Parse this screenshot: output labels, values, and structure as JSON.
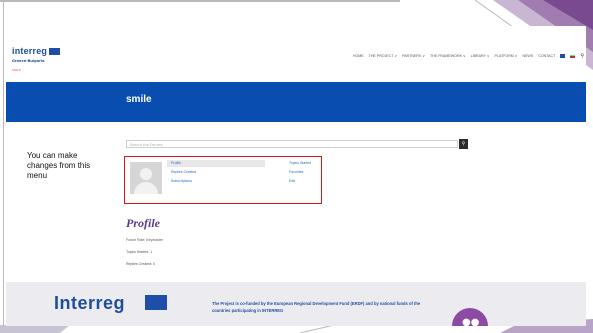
{
  "site": {
    "logo_text": "interreg",
    "logo_subtitle": "Greece-Bulgaria",
    "logo_small": "SMILE"
  },
  "nav": {
    "items": [
      "HOME",
      "THE PROJECT ∨",
      "PARTNERS ∨",
      "THE FRAMEWORK ∨",
      "LIBRARY ∨",
      "PLATFORM ∨",
      "NEWS",
      "CONTACT"
    ],
    "search_icon": "search-icon"
  },
  "banner": {
    "title": "smile"
  },
  "search": {
    "placeholder": "Search the Forums"
  },
  "profile_menu": {
    "col1": [
      "Profile",
      "Replies Created",
      "Subscriptions"
    ],
    "col2": [
      "Topics Started",
      "Favorites",
      "Edit"
    ]
  },
  "profile": {
    "heading": "Profile",
    "role": "Forum Role: Keymaster",
    "topics": "Topics Started: 1",
    "replies": "Replies Created: 0"
  },
  "footer": {
    "logo": "Interreg",
    "text": "The Project is co-funded by the European Regional Development Fund (ERDF) and by national funds of the countries participating in INTERREG"
  },
  "annotation": {
    "text": "You can make changes from this menu"
  },
  "colors": {
    "banner": "#0a4db0",
    "highlight_border": "#d9141d",
    "profile_heading": "#5b3b8c",
    "footer_circle": "#8d4aa5"
  }
}
